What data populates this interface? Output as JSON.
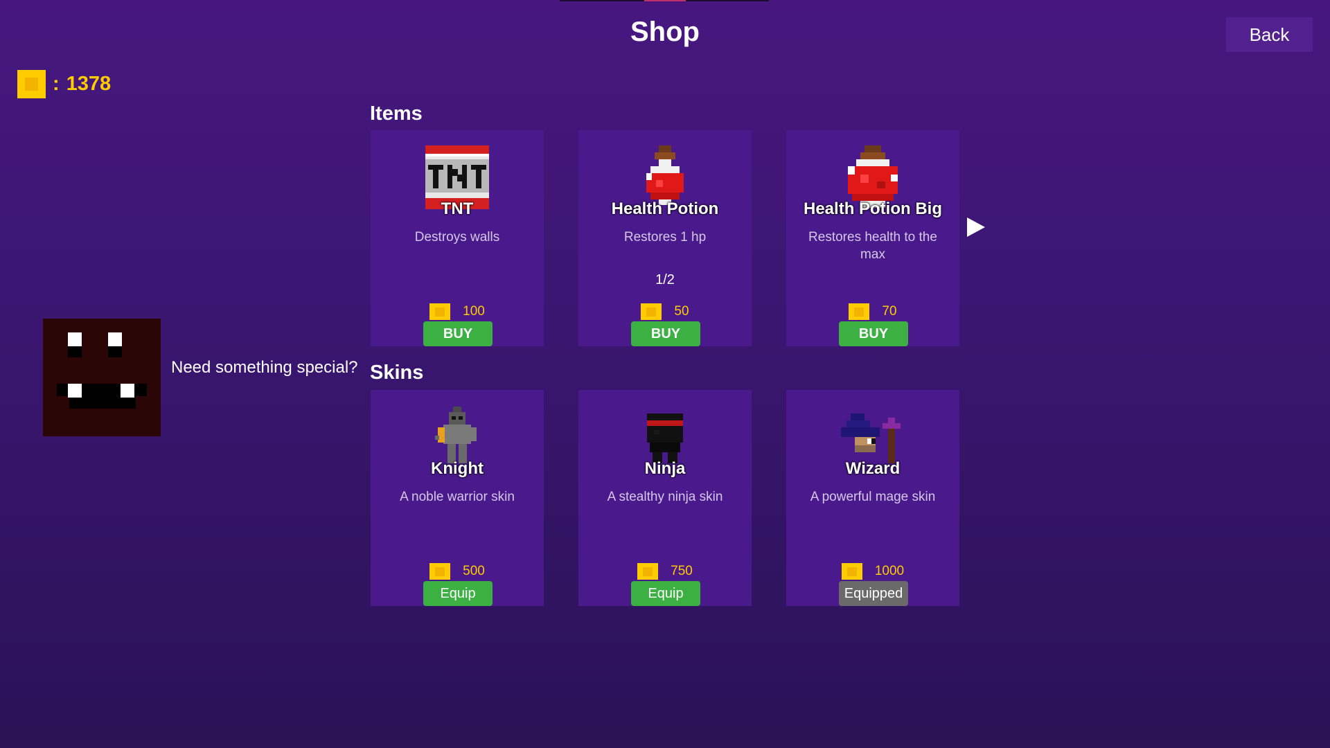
{
  "header": {
    "title": "Shop",
    "back_label": "Back"
  },
  "wallet": {
    "separator": ":",
    "coins": "1378"
  },
  "npc": {
    "dialogue": "Need something special?"
  },
  "items": {
    "heading": "Items",
    "page_indicator": "1/2",
    "cards": [
      {
        "name": "TNT",
        "description": "Destroys walls",
        "price": "100",
        "button": "BUY",
        "icon": "tnt-icon"
      },
      {
        "name": "Health Potion",
        "description": "Restores 1 hp",
        "price": "50",
        "button": "BUY",
        "icon": "health-potion-icon"
      },
      {
        "name": "Health Potion Big",
        "description": "Restores health to the max",
        "price": "70",
        "button": "BUY",
        "icon": "health-potion-big-icon"
      }
    ]
  },
  "skins": {
    "heading": "Skins",
    "cards": [
      {
        "name": "Knight",
        "description": "A noble warrior skin",
        "price": "500",
        "button": "Equip",
        "icon": "knight-icon"
      },
      {
        "name": "Ninja",
        "description": "A stealthy ninja skin",
        "price": "750",
        "button": "Equip",
        "icon": "ninja-icon"
      },
      {
        "name": "Wizard",
        "description": "A powerful mage skin",
        "price": "1000",
        "button": "Equipped",
        "icon": "wizard-icon"
      }
    ]
  },
  "colors": {
    "coin": "#ffcc00",
    "buy_button": "#3cb043",
    "equipped_button": "#6a6a6a",
    "card": "#4a1a8c"
  }
}
